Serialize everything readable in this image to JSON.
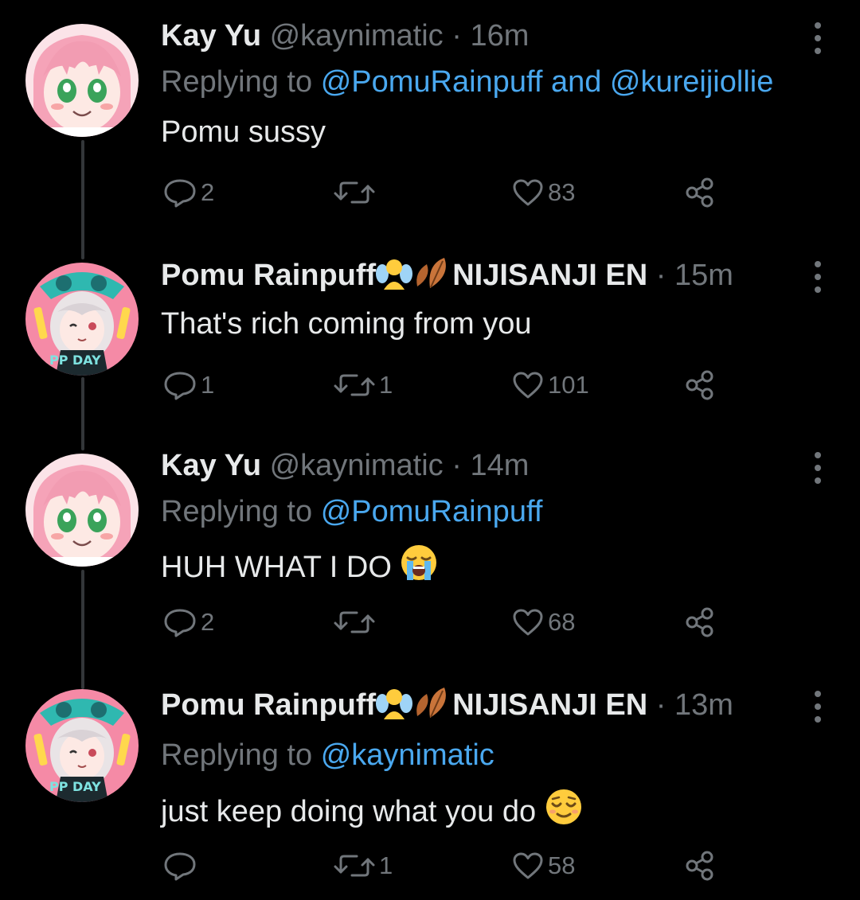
{
  "tweets": [
    {
      "name": "Kay Yu",
      "name_emojis": [],
      "name_suffix": "",
      "handle": "@kaynimatic",
      "time": "16m",
      "replying_label": "Replying to",
      "replying_to": [
        "@PomuRainpuff",
        "@kureijiollie"
      ],
      "replying_joiner": "and",
      "text": "Pomu sussy",
      "text_emoji": "",
      "replies": "2",
      "retweets": "",
      "likes": "83",
      "avatar": "kay-avatar"
    },
    {
      "name": "Pomu Rainpuff",
      "name_emojis": [
        "fairy",
        "leaves"
      ],
      "name_suffix": "NIJISANJI EN",
      "handle": "",
      "time": "15m",
      "replying_label": "",
      "replying_to": [],
      "replying_joiner": "",
      "text": "That's rich coming from you",
      "text_emoji": "",
      "replies": "1",
      "retweets": "1",
      "likes": "101",
      "avatar": "pomu-avatar"
    },
    {
      "name": "Kay Yu",
      "name_emojis": [],
      "name_suffix": "",
      "handle": "@kaynimatic",
      "time": "14m",
      "replying_label": "Replying to",
      "replying_to": [
        "@PomuRainpuff"
      ],
      "replying_joiner": "",
      "text": "HUH WHAT I DO",
      "text_emoji": "loudly-crying-face",
      "replies": "2",
      "retweets": "",
      "likes": "68",
      "avatar": "kay-avatar"
    },
    {
      "name": "Pomu Rainpuff",
      "name_emojis": [
        "fairy",
        "leaves"
      ],
      "name_suffix": "NIJISANJI EN",
      "handle": "",
      "time": "13m",
      "replying_label": "Replying to",
      "replying_to": [
        "@kaynimatic"
      ],
      "replying_joiner": "",
      "text": "just keep doing what you do",
      "text_emoji": "relieved-face",
      "replies": "",
      "retweets": "1",
      "likes": "58",
      "avatar": "pomu-avatar"
    }
  ],
  "colors": {
    "background": "#000000",
    "text": "#e7e9ea",
    "muted": "#71767b",
    "link": "#4aa8ef",
    "thread_line": "#333639"
  }
}
